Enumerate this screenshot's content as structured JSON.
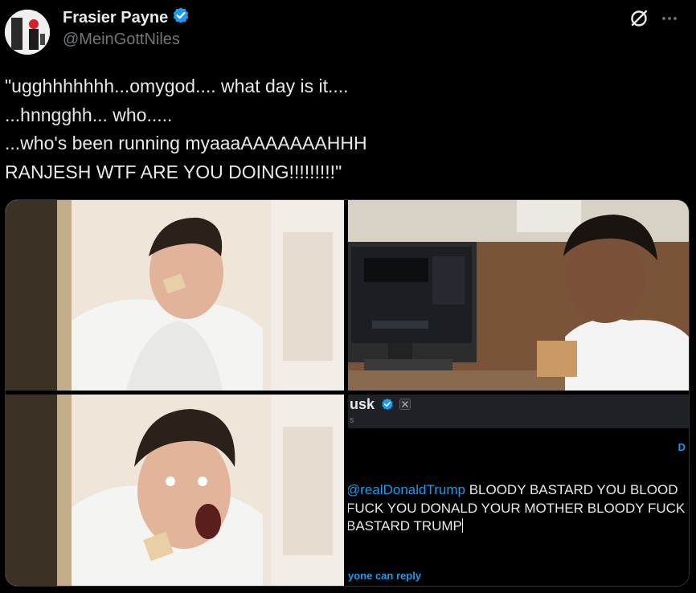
{
  "author": {
    "name": "Frasier Payne",
    "handle": "@MeinGottNiles",
    "verified": true
  },
  "icons": {
    "grok": "grok-icon",
    "more": "more-options-icon",
    "verified": "verified-badge-icon"
  },
  "tweet": {
    "text": "\"ugghhhhhhh...omygod.... what day is it....\n...hnngghh... who.....\n...who's been running myaaaAAAAAAAHHH\nRANJESH WTF ARE YOU DOING!!!!!!!!!\""
  },
  "media": {
    "panel4": {
      "profile_name": "usk",
      "profile_sub": "s",
      "right_link": "D",
      "composer_mention": "@realDonaldTrump",
      "composer_line1": " BLOODY BASTARD YOU BLOOD",
      "composer_line2": "FUCK YOU DONALD YOUR MOTHER BLOODY FUCK",
      "composer_line3": "BASTARD TRUMP",
      "reply_setting": "yone can reply"
    }
  },
  "colors": {
    "background": "#000000",
    "text": "#e7e9ea",
    "secondary": "#71767b",
    "accent": "#1d9bf0"
  }
}
